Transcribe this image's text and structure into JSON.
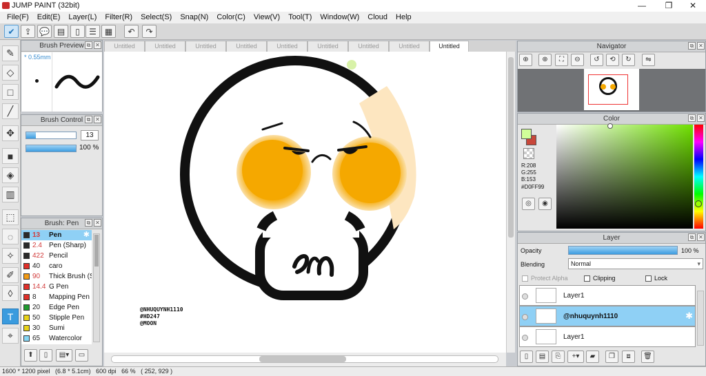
{
  "window": {
    "title": "JUMP PAINT (32bit)",
    "minimize": "—",
    "maximize": "❐",
    "close": "✕"
  },
  "menu": [
    "File(F)",
    "Edit(E)",
    "Layer(L)",
    "Filter(R)",
    "Select(S)",
    "Snap(N)",
    "Color(C)",
    "View(V)",
    "Tool(T)",
    "Window(W)",
    "Cloud",
    "Help"
  ],
  "toolbar": {
    "icons": [
      "check-icon",
      "export-icon",
      "speech-icon",
      "message-icon",
      "page-icon",
      "list-icon",
      "grid-icon",
      "undo-icon",
      "redo-icon"
    ]
  },
  "tools": [
    "pen-icon",
    "eraser-icon",
    "rectangle-icon",
    "brush-icon",
    "move-icon",
    "fill-rect-icon",
    "bucket-icon",
    "gradient-icon",
    "select-rect-icon",
    "lasso-icon",
    "wand-icon",
    "pen-select-icon",
    "select-erase-icon",
    "text-icon",
    "dropper-icon"
  ],
  "brush_preview": {
    "title": "Brush Preview",
    "size_label": "* 0.55mm"
  },
  "brush_control": {
    "title": "Brush Control",
    "size_value": "13",
    "opacity_value": "100 %",
    "size_fraction": 0.2,
    "opacity_fraction": 1.0
  },
  "brush_list": {
    "title": "Brush: Pen",
    "items": [
      {
        "color": "#2a2a2a",
        "size": "13",
        "name": "Pen",
        "selected": true,
        "red": true
      },
      {
        "color": "#2a2a2a",
        "size": "2.4",
        "name": "Pen (Sharp)",
        "red": true
      },
      {
        "color": "#2a2a2a",
        "size": "422",
        "name": "Pencil",
        "red": true
      },
      {
        "color": "#e0302a",
        "size": "40",
        "name": "caro"
      },
      {
        "color": "#f29a14",
        "size": "90",
        "name": "Thick Brush (Si",
        "red": true
      },
      {
        "color": "#e0302a",
        "size": "14.4",
        "name": "G Pen",
        "red": true
      },
      {
        "color": "#e0302a",
        "size": "8",
        "name": "Mapping Pen"
      },
      {
        "color": "#1f9a2e",
        "size": "20",
        "name": "Edge Pen"
      },
      {
        "color": "#e8d21a",
        "size": "50",
        "name": "Stipple Pen"
      },
      {
        "color": "#e8d21a",
        "size": "30",
        "name": "Sumi"
      },
      {
        "color": "#86d6f5",
        "size": "65",
        "name": "Watercolor"
      }
    ]
  },
  "doc_tabs": [
    "Untitled",
    "Untitled",
    "Untitled",
    "Untitled",
    "Untitled",
    "Untitled",
    "Untitled",
    "Untitled",
    "Untitled"
  ],
  "canvas": {
    "watermark_lines": [
      "@NHUQUYNH1110",
      "#HD247",
      "@MOON"
    ]
  },
  "navigator": {
    "title": "Navigator"
  },
  "color": {
    "title": "Color",
    "r": "R:208",
    "g": "G:255",
    "b": "B:153",
    "hex": "#D0FF99",
    "fg": "#d0ff99",
    "bg": "#c8473a"
  },
  "layer": {
    "title": "Layer",
    "opacity_label": "Opacity",
    "opacity_value": "100 %",
    "opacity_fraction": 1.0,
    "blending_label": "Blending",
    "blending_value": "Normal",
    "protect_alpha": "Protect Alpha",
    "clipping": "Clipping",
    "lock": "Lock",
    "rows": [
      {
        "name": "Layer1",
        "selected": false
      },
      {
        "name": "@nhuquynh1110",
        "selected": true
      },
      {
        "name": "Layer1",
        "selected": false
      }
    ]
  },
  "status": {
    "text": "1600 * 1200 pixel   (6.8 * 5.1cm)   600 dpi   66 %   ( 252, 929 )"
  }
}
